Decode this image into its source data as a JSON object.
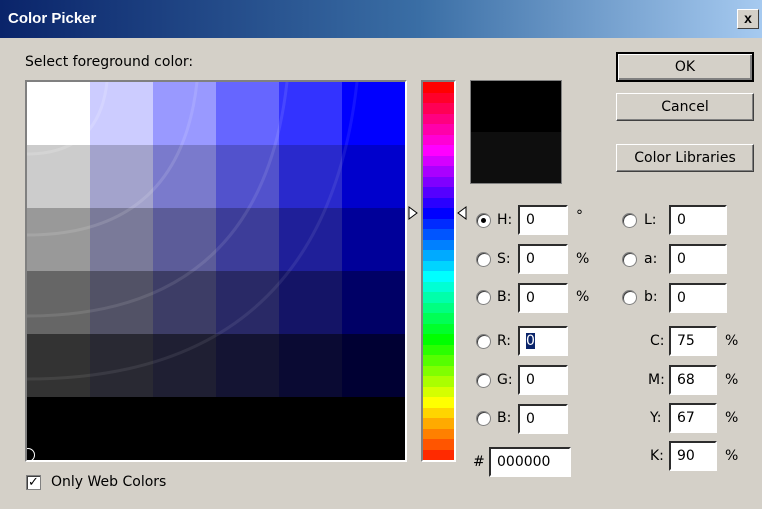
{
  "window": {
    "title": "Color Picker",
    "close_label": "x"
  },
  "prompt": "Select foreground color:",
  "buttons": {
    "ok": "OK",
    "cancel": "Cancel",
    "libraries": "Color Libraries"
  },
  "only_web_colors": {
    "label": "Only Web Colors",
    "checked": true
  },
  "hsb": [
    {
      "label": "H:",
      "value": "0",
      "unit": "°",
      "selected": true
    },
    {
      "label": "S:",
      "value": "0",
      "unit": "%",
      "selected": false
    },
    {
      "label": "B:",
      "value": "0",
      "unit": "%",
      "selected": false
    }
  ],
  "rgb": [
    {
      "label": "R:",
      "value": "0",
      "selected": false
    },
    {
      "label": "G:",
      "value": "0",
      "selected": false
    },
    {
      "label": "B:",
      "value": "0",
      "selected": false
    }
  ],
  "lab": [
    {
      "label": "L:",
      "value": "0",
      "selected": false
    },
    {
      "label": "a:",
      "value": "0",
      "selected": false
    },
    {
      "label": "b:",
      "value": "0",
      "selected": false
    }
  ],
  "cmyk": [
    {
      "label": "C:",
      "value": "75",
      "unit": "%"
    },
    {
      "label": "M:",
      "value": "68",
      "unit": "%"
    },
    {
      "label": "Y:",
      "value": "67",
      "unit": "%"
    },
    {
      "label": "K:",
      "value": "90",
      "unit": "%"
    }
  ],
  "hex": {
    "label": "#",
    "value": "000000"
  },
  "colors": {
    "new_color": "#000000",
    "current_color": "#0e0e0e",
    "field_hue": "#0000ff"
  },
  "icons": {
    "hue_slider_left": "triangle-right-icon",
    "hue_slider_right": "triangle-left-icon",
    "field_marker": "circle-marker-icon",
    "check": "checkmark-icon"
  }
}
